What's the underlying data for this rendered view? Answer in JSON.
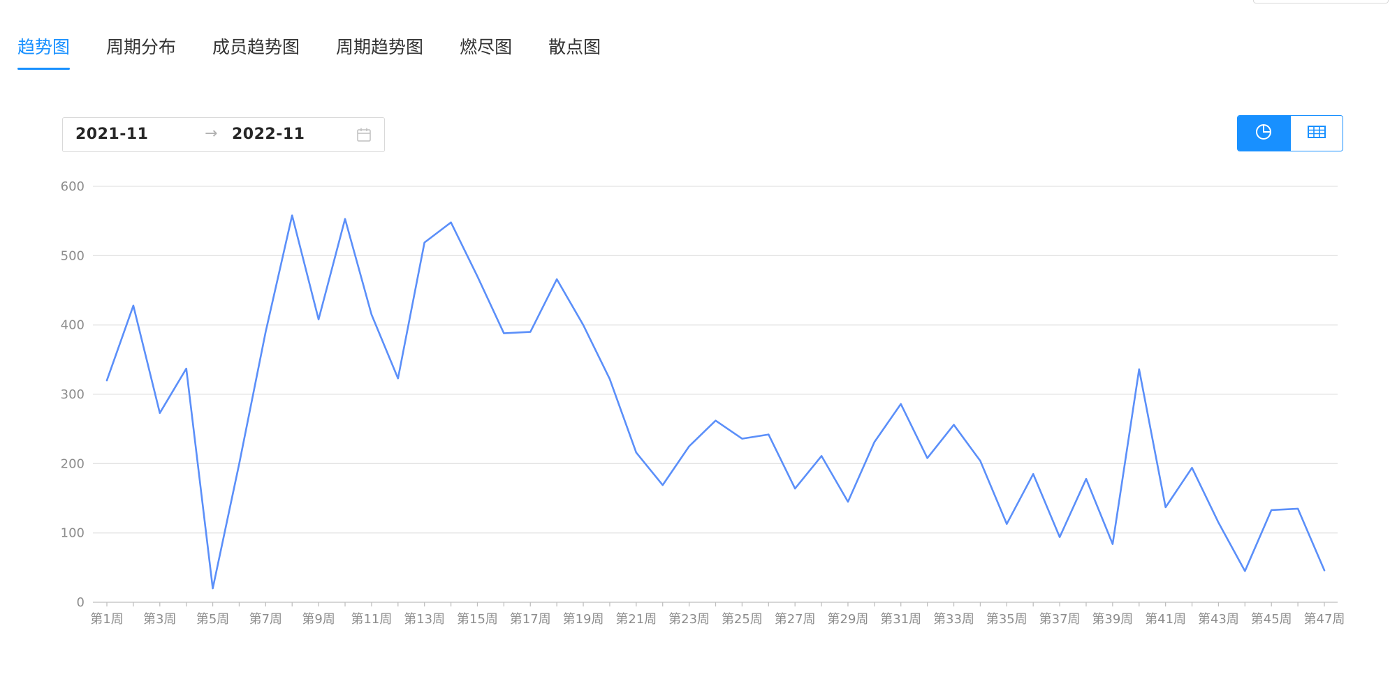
{
  "tabs": [
    {
      "label": "趋势图",
      "active": true
    },
    {
      "label": "周期分布",
      "active": false
    },
    {
      "label": "成员趋势图",
      "active": false
    },
    {
      "label": "周期趋势图",
      "active": false
    },
    {
      "label": "燃尽图",
      "active": false
    },
    {
      "label": "散点图",
      "active": false
    }
  ],
  "range": {
    "start": "2021-11",
    "separator": "→",
    "end": "2022-11",
    "icon": "calendar-icon"
  },
  "view_toggle": {
    "options": [
      "chart-icon",
      "table-icon"
    ],
    "selected": "chart-icon"
  },
  "colors": {
    "accent": "#1890ff",
    "series": "#5B8FF9"
  },
  "chart_data": {
    "type": "line",
    "title": "",
    "xlabel": "",
    "ylabel": "",
    "ylim": [
      0,
      600
    ],
    "yticks": [
      0,
      100,
      200,
      300,
      400,
      500,
      600
    ],
    "grid": true,
    "x": [
      "第1周",
      "第2周",
      "第3周",
      "第4周",
      "第5周",
      "第6周",
      "第7周",
      "第8周",
      "第9周",
      "第10周",
      "第11周",
      "第12周",
      "第13周",
      "第14周",
      "第15周",
      "第16周",
      "第17周",
      "第18周",
      "第19周",
      "第20周",
      "第21周",
      "第22周",
      "第23周",
      "第24周",
      "第25周",
      "第26周",
      "第27周",
      "第28周",
      "第29周",
      "第30周",
      "第31周",
      "第32周",
      "第33周",
      "第34周",
      "第35周",
      "第36周",
      "第37周",
      "第38周",
      "第39周",
      "第40周",
      "第41周",
      "第42周",
      "第43周",
      "第44周",
      "第45周",
      "第46周",
      "第47周"
    ],
    "x_tick_labels": [
      "第1周",
      "第3周",
      "第5周",
      "第7周",
      "第9周",
      "第11周",
      "第13周",
      "第15周",
      "第17周",
      "第19周",
      "第21周",
      "第23周",
      "第25周",
      "第27周",
      "第29周",
      "第31周",
      "第33周",
      "第35周",
      "第37周",
      "第39周",
      "第41周",
      "第43周",
      "第45周",
      "第47周"
    ],
    "series": [
      {
        "values": [
          320,
          428,
          273,
          337,
          20,
          200,
          390,
          558,
          408,
          553,
          415,
          323,
          519,
          548,
          470,
          388,
          390,
          466,
          400,
          322,
          216,
          169,
          225,
          262,
          236,
          242,
          164,
          211,
          145,
          231,
          286,
          208,
          256,
          204,
          113,
          185,
          94,
          178,
          84,
          336,
          137,
          194,
          115,
          45,
          133,
          135,
          46
        ]
      }
    ]
  }
}
